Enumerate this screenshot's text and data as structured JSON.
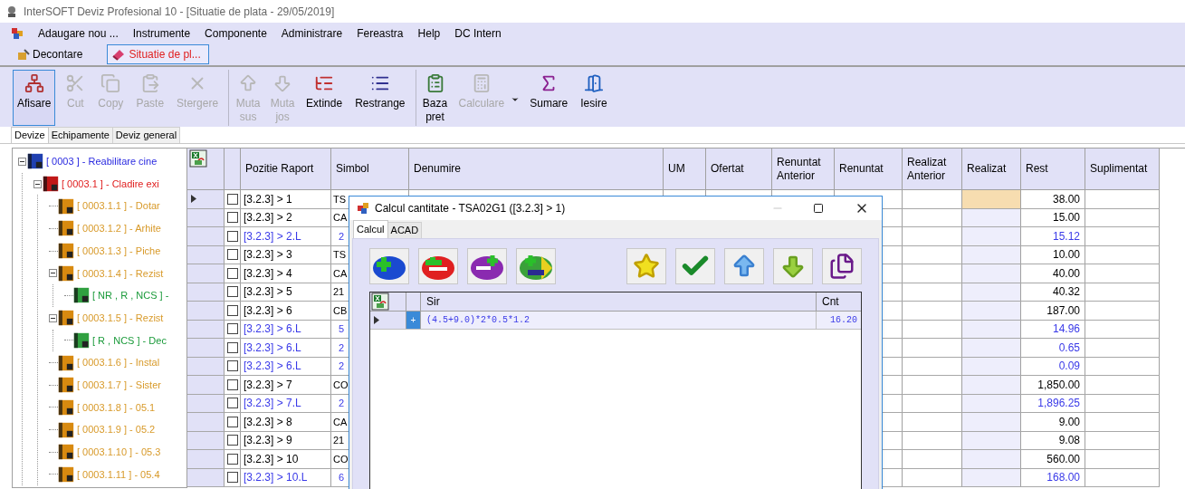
{
  "window": {
    "title": "InterSOFT Deviz Profesional 10 - [Situatie de plata - 29/05/2019]"
  },
  "menu": {
    "items": [
      "Adaugare nou ...",
      "Instrumente",
      "Componente",
      "Administrare",
      "Fereastra",
      "Help",
      "DC Intern"
    ]
  },
  "doc_tabs": [
    {
      "label": "Decontare",
      "selected": false
    },
    {
      "label": "Situatie de pl...",
      "selected": true
    }
  ],
  "toolbar": {
    "groups": [
      [
        {
          "label": "Afisare",
          "pressed": true,
          "disabled": false,
          "stacked": false
        },
        {
          "label": "Cut",
          "pressed": false,
          "disabled": true,
          "stacked": false
        },
        {
          "label": "Copy",
          "pressed": false,
          "disabled": true,
          "stacked": false
        },
        {
          "label": "Paste",
          "pressed": false,
          "disabled": true,
          "stacked": false
        },
        {
          "label": "Stergere",
          "pressed": false,
          "disabled": true,
          "stacked": false
        }
      ],
      [
        {
          "label": "Muta sus",
          "pressed": false,
          "disabled": true,
          "stacked": true
        },
        {
          "label": "Muta jos",
          "pressed": false,
          "disabled": true,
          "stacked": true
        },
        {
          "label": "Extinde",
          "pressed": false,
          "disabled": false,
          "stacked": false
        },
        {
          "label": "Restrange",
          "pressed": false,
          "disabled": false,
          "stacked": false
        }
      ],
      [
        {
          "label": "Baza pret",
          "pressed": false,
          "disabled": false,
          "stacked": true
        },
        {
          "label": "Calculare",
          "pressed": false,
          "disabled": true,
          "stacked": false,
          "dropdown": true
        },
        {
          "label": "Sumare",
          "pressed": false,
          "disabled": false,
          "stacked": false
        },
        {
          "label": "Iesire",
          "pressed": false,
          "disabled": false,
          "stacked": false
        }
      ]
    ]
  },
  "panel_tabs": [
    {
      "label": "Devize",
      "selected": true
    },
    {
      "label": "Echipamente",
      "selected": false
    },
    {
      "label": "Deviz general",
      "selected": false
    }
  ],
  "tree": [
    {
      "kind": "project",
      "label": "[ 0003 ] - Reabilitare cine",
      "expanded": true,
      "children": [
        {
          "kind": "object",
          "label": "[ 0003.1 ] - Cladire exi",
          "expanded": true,
          "children": [
            {
              "kind": "deviz",
              "label": "[ 0003.1.1 ] - Dotar"
            },
            {
              "kind": "deviz",
              "label": "[ 0003.1.2 ] - Arhite"
            },
            {
              "kind": "deviz",
              "label": "[ 0003.1.3 ] - Piche"
            },
            {
              "kind": "deviz",
              "label": "[ 0003.1.4 ] - Rezist",
              "expanded": true,
              "children": [
                {
                  "kind": "subdeviz",
                  "label": "[ NR , R , NCS ] -"
                }
              ]
            },
            {
              "kind": "deviz",
              "label": "[ 0003.1.5 ] - Rezist",
              "expanded": true,
              "children": [
                {
                  "kind": "subdeviz",
                  "label": "[ R , NCS ] - Dec"
                }
              ]
            },
            {
              "kind": "deviz",
              "label": "[ 0003.1.6 ] - Instal"
            },
            {
              "kind": "deviz",
              "label": "[ 0003.1.7 ] - Sister"
            },
            {
              "kind": "deviz",
              "label": "[ 0003.1.8 ] - 05.1"
            },
            {
              "kind": "deviz",
              "label": "[ 0003.1.9 ] - 05.2"
            },
            {
              "kind": "deviz",
              "label": "[ 0003.1.10 ] - 05.3"
            },
            {
              "kind": "deviz",
              "label": "[ 0003.1.11 ] - 05.4"
            }
          ]
        }
      ]
    }
  ],
  "grid": {
    "columns": [
      "Pozitie Raport",
      "Simbol",
      "Denumire",
      "UM",
      "Ofertat",
      "Renuntat Anterior",
      "Renuntat",
      "Realizat Anterior",
      "Realizat",
      "Rest",
      "Suplimentat"
    ],
    "rows": [
      {
        "kind": "item",
        "selected": true,
        "checked": false,
        "position": "[3.2.3] > 1",
        "symbol": "TS",
        "rest": "38.00"
      },
      {
        "kind": "item",
        "selected": false,
        "checked": false,
        "position": "[3.2.3] > 2",
        "symbol": "CA",
        "rest": "15.00"
      },
      {
        "kind": "sub",
        "selected": false,
        "checked": false,
        "position": "[3.2.3] > 2.L",
        "symbol": "2",
        "rest": "15.12"
      },
      {
        "kind": "item",
        "selected": false,
        "checked": false,
        "position": "[3.2.3] > 3",
        "symbol": "TS",
        "rest": "10.00"
      },
      {
        "kind": "item",
        "selected": false,
        "checked": false,
        "position": "[3.2.3] > 4",
        "symbol": "CA",
        "rest": "40.00"
      },
      {
        "kind": "item",
        "selected": false,
        "checked": false,
        "position": "[3.2.3] > 5",
        "symbol": "21",
        "rest": "40.32"
      },
      {
        "kind": "item",
        "selected": false,
        "checked": false,
        "position": "[3.2.3] > 6",
        "symbol": "CB",
        "rest": "187.00"
      },
      {
        "kind": "sub",
        "selected": false,
        "checked": false,
        "position": "[3.2.3] > 6.L",
        "symbol": "5",
        "rest": "14.96"
      },
      {
        "kind": "sub",
        "selected": false,
        "checked": false,
        "position": "[3.2.3] > 6.L",
        "symbol": "2",
        "rest": "0.65"
      },
      {
        "kind": "sub",
        "selected": false,
        "checked": false,
        "position": "[3.2.3] > 6.L",
        "symbol": "2",
        "rest": "0.09"
      },
      {
        "kind": "item",
        "selected": false,
        "checked": false,
        "position": "[3.2.3] > 7",
        "symbol": "CO",
        "rest": "1,850.00"
      },
      {
        "kind": "sub",
        "selected": false,
        "checked": false,
        "position": "[3.2.3] > 7.L",
        "symbol": "2",
        "rest": "1,896.25"
      },
      {
        "kind": "item",
        "selected": false,
        "checked": false,
        "position": "[3.2.3] > 8",
        "symbol": "CA",
        "rest": "9.00"
      },
      {
        "kind": "item",
        "selected": false,
        "checked": false,
        "position": "[3.2.3] > 9",
        "symbol": "21",
        "rest": "9.08"
      },
      {
        "kind": "item",
        "selected": false,
        "checked": false,
        "position": "[3.2.3] > 10",
        "symbol": "CO",
        "rest": "560.00"
      },
      {
        "kind": "sub",
        "selected": false,
        "checked": false,
        "position": "[3.2.3] > 10.L",
        "symbol": "6",
        "rest": "168.00"
      }
    ]
  },
  "dialog": {
    "title": "Calcul cantitate - TSA02G1 ([3.2.3] > 1)",
    "tabs": [
      {
        "label": "Calcul",
        "selected": true
      },
      {
        "label": "ACAD",
        "selected": false
      }
    ],
    "grid": {
      "columns": [
        "Sir",
        "Cnt"
      ],
      "rows": [
        {
          "selected": true,
          "sign": "+",
          "expression": "(4.5+9.0)*2*0.5*1.2",
          "count": "16.20"
        }
      ]
    }
  }
}
